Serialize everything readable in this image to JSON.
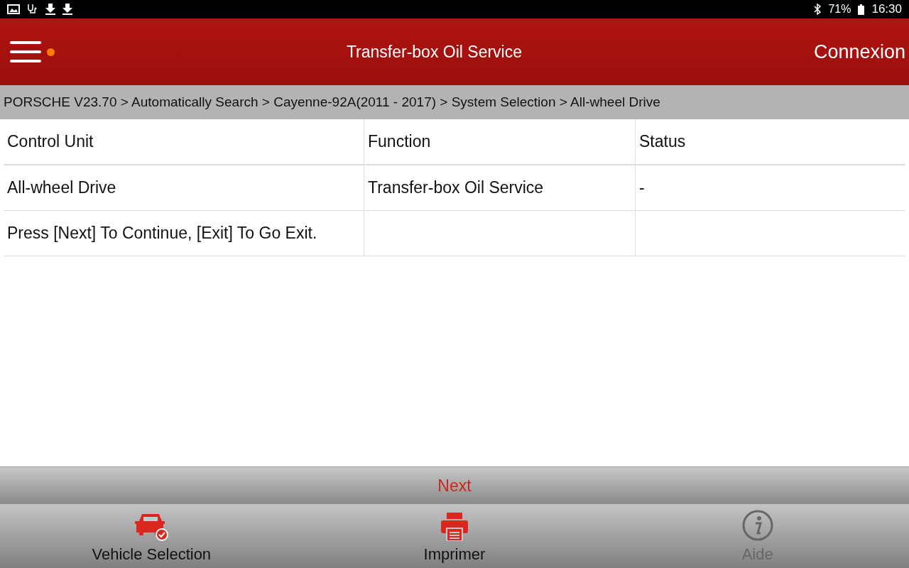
{
  "status_bar": {
    "battery": "71%",
    "time": "16:30"
  },
  "header": {
    "title": "Transfer-box Oil Service",
    "notification": true,
    "login": "Connexion"
  },
  "breadcrumb": "PORSCHE V23.70 > Automatically Search > Cayenne-92A(2011 - 2017) > System Selection > All-wheel Drive",
  "table": {
    "columns": [
      "Control Unit",
      "Function",
      "Status"
    ],
    "rows": [
      [
        "All-wheel Drive",
        "Transfer-box Oil Service",
        "-"
      ],
      [
        "Press [Next] To Continue, [Exit] To Go Exit.",
        "",
        ""
      ]
    ]
  },
  "next_button": "Next",
  "bottom_nav": [
    {
      "kind": "vehicle",
      "label": "Vehicle Selection",
      "disabled": false
    },
    {
      "kind": "print",
      "label": "Imprimer",
      "disabled": false
    },
    {
      "kind": "help",
      "label": "Aide",
      "disabled": true
    }
  ]
}
